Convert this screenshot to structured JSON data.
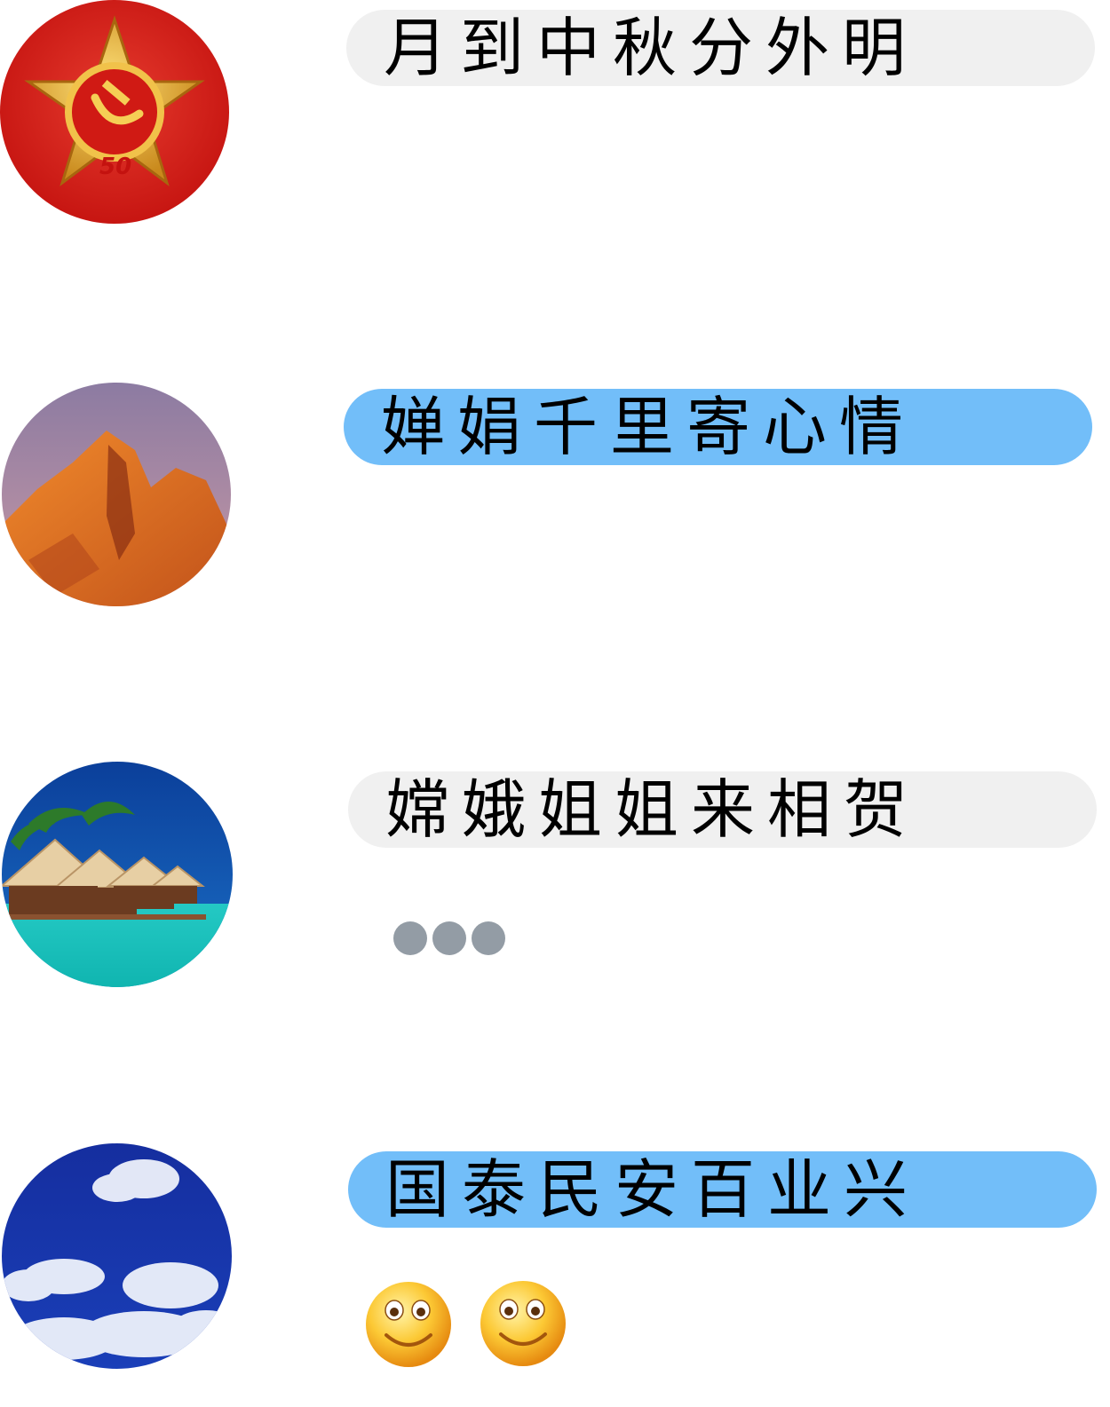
{
  "chat": {
    "messages": [
      {
        "avatar_icon": "party-medal-icon",
        "text": "月到中秋分外明",
        "bubble_color": "#f0f0f0"
      },
      {
        "avatar_icon": "red-rock-mountain-icon",
        "text": "婵娟千里寄心情",
        "bubble_color": "#72bef9"
      },
      {
        "avatar_icon": "beach-huts-icon",
        "text": "嫦娥姐姐来相贺",
        "bubble_color": "#f0f0f0",
        "typing_indicator_icon": "typing-dots-icon"
      },
      {
        "avatar_icon": "blue-sky-clouds-icon",
        "text": "国泰民安百业兴",
        "bubble_color": "#72bef9",
        "emojis": [
          "smiley-icon",
          "smiley-icon"
        ]
      }
    ]
  },
  "colors": {
    "bubble_gray": "#f0f0f0",
    "bubble_blue": "#72bef9",
    "typing_dot": "#939ca5"
  }
}
